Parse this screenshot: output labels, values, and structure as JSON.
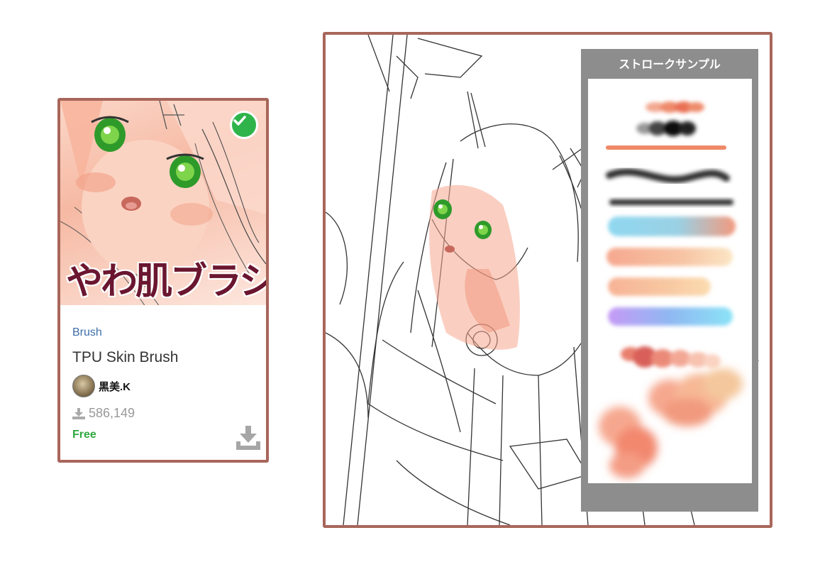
{
  "card": {
    "thumbnail_title": "やわ肌ブラシ",
    "category": "Brush",
    "title": "TPU Skin Brush",
    "author": "黒美.K",
    "downloads": "586,149",
    "price": "Free",
    "icons": {
      "badge": "check-circle-icon",
      "downloads": "download-icon",
      "download_button": "download-tray-icon"
    }
  },
  "preview": {
    "stroke_panel_title": "ストロークサンプル"
  },
  "colors": {
    "frame": "#a8665a",
    "category": "#3e6fa8",
    "free": "#2ea83d",
    "check": "#2fb44c",
    "thumb_title": "#6b1630",
    "panel": "#8d8d8d"
  }
}
